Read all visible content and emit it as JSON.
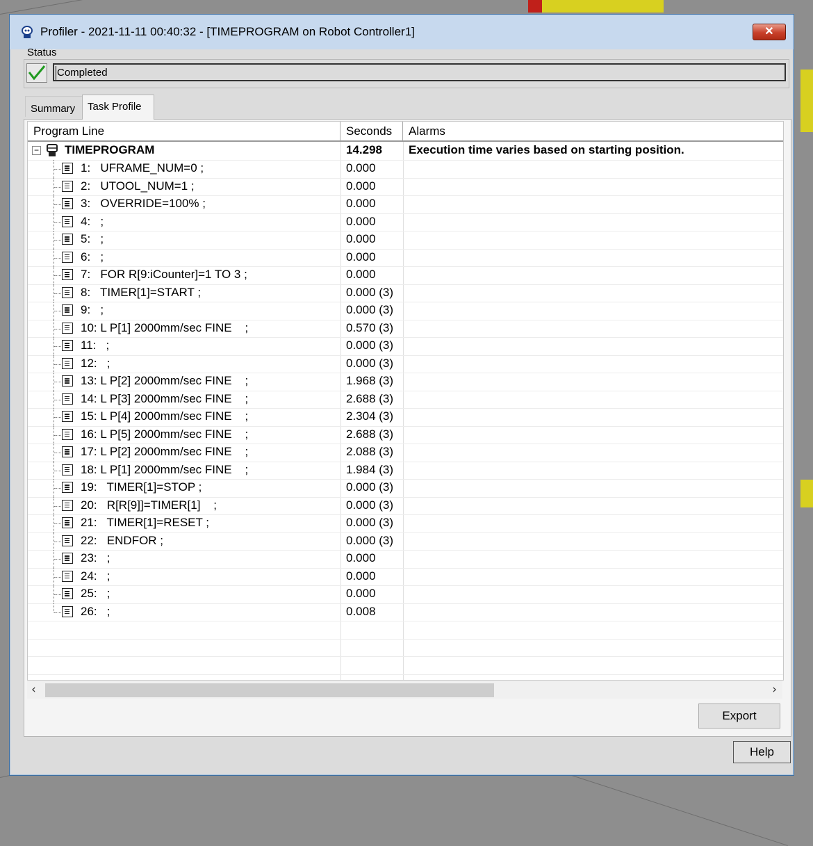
{
  "window": {
    "title": "Profiler - 2021-11-11 00:40:32 - [TIMEPROGRAM on Robot Controller1]",
    "close_label": "✕"
  },
  "status": {
    "label": "Status",
    "value": "Completed"
  },
  "tabs": [
    {
      "label": "Summary",
      "active": false
    },
    {
      "label": "Task Profile",
      "active": true
    }
  ],
  "grid": {
    "columns": [
      "Program Line",
      "Seconds",
      "Alarms"
    ],
    "root": {
      "name": "TIMEPROGRAM",
      "seconds": "14.298",
      "alarm": "Execution time varies based on starting position.",
      "expand_symbol": "−"
    },
    "rows": [
      {
        "line": "1:   UFRAME_NUM=0 ;",
        "seconds": "0.000"
      },
      {
        "line": "2:   UTOOL_NUM=1 ;",
        "seconds": "0.000"
      },
      {
        "line": "3:   OVERRIDE=100% ;",
        "seconds": "0.000"
      },
      {
        "line": "4:   ;",
        "seconds": "0.000"
      },
      {
        "line": "5:   ;",
        "seconds": "0.000"
      },
      {
        "line": "6:   ;",
        "seconds": "0.000"
      },
      {
        "line": "7:   FOR R[9:iCounter]=1 TO 3 ;",
        "seconds": "0.000"
      },
      {
        "line": "8:   TIMER[1]=START ;",
        "seconds": "0.000 (3)"
      },
      {
        "line": "9:   ;",
        "seconds": "0.000 (3)"
      },
      {
        "line": "10: L P[1] 2000mm/sec FINE    ;",
        "seconds": "0.570 (3)"
      },
      {
        "line": "11:   ;",
        "seconds": "0.000 (3)"
      },
      {
        "line": "12:   ;",
        "seconds": "0.000 (3)"
      },
      {
        "line": "13: L P[2] 2000mm/sec FINE    ;",
        "seconds": "1.968 (3)"
      },
      {
        "line": "14: L P[3] 2000mm/sec FINE    ;",
        "seconds": "2.688 (3)"
      },
      {
        "line": "15: L P[4] 2000mm/sec FINE    ;",
        "seconds": "2.304 (3)"
      },
      {
        "line": "16: L P[5] 2000mm/sec FINE    ;",
        "seconds": "2.688 (3)"
      },
      {
        "line": "17: L P[2] 2000mm/sec FINE    ;",
        "seconds": "2.088 (3)"
      },
      {
        "line": "18: L P[1] 2000mm/sec FINE    ;",
        "seconds": "1.984 (3)"
      },
      {
        "line": "19:   TIMER[1]=STOP ;",
        "seconds": "0.000 (3)"
      },
      {
        "line": "20:   R[R[9]]=TIMER[1]    ;",
        "seconds": "0.000 (3)"
      },
      {
        "line": "21:   TIMER[1]=RESET ;",
        "seconds": "0.000 (3)"
      },
      {
        "line": "22:   ENDFOR ;",
        "seconds": "0.000 (3)"
      },
      {
        "line": "23:   ;",
        "seconds": "0.000"
      },
      {
        "line": "24:   ;",
        "seconds": "0.000"
      },
      {
        "line": "25:   ;",
        "seconds": "0.000"
      },
      {
        "line": "26:   ;",
        "seconds": "0.008"
      }
    ]
  },
  "scroll": {
    "left": "‹",
    "right": "›"
  },
  "buttons": {
    "export": "Export",
    "help": "Help"
  },
  "icons": {
    "title": "profiler-icon",
    "status": "check-icon",
    "line": "document-lines-icon",
    "root": "robot-program-icon"
  },
  "colors": {
    "check": "#1f9a1f",
    "titlebar": "#c7d9ee",
    "close": "#c8402a"
  }
}
